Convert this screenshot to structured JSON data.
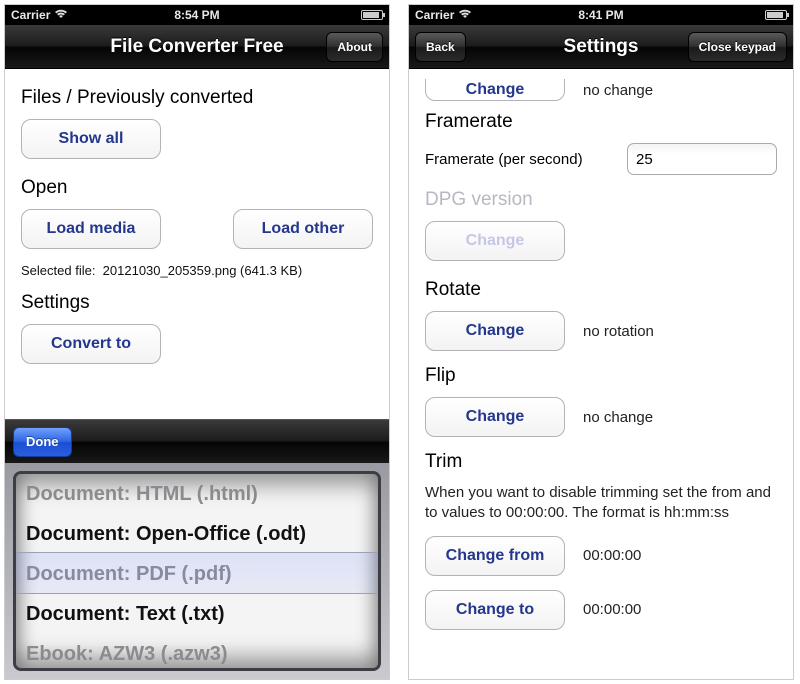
{
  "left": {
    "statusbar": {
      "carrier": "Carrier",
      "time": "8:54 PM"
    },
    "navbar": {
      "title": "File Converter Free",
      "about": "About"
    },
    "files_section": {
      "label": "Files / Previously converted",
      "show_all": "Show all"
    },
    "open_section": {
      "label": "Open",
      "load_media": "Load media",
      "load_other": "Load other",
      "selected_prefix": "Selected file:",
      "selected_file": "20121030_205359.png (641.3 KB)"
    },
    "settings_section": {
      "label": "Settings",
      "convert_to": "Convert to"
    },
    "picker": {
      "done": "Done",
      "items": [
        "Document: HTML (.html)",
        "Document: Open-Office (.odt)",
        "Document: PDF (.pdf)",
        "Document: Text (.txt)",
        "Ebook: AZW3 (.azw3)"
      ],
      "selected_index": 2
    }
  },
  "right": {
    "statusbar": {
      "carrier": "Carrier",
      "time": "8:41 PM"
    },
    "navbar": {
      "back": "Back",
      "title": "Settings",
      "close_keypad": "Close keypad"
    },
    "top_partial": {
      "button": "Change",
      "value": "no change"
    },
    "framerate": {
      "label": "Framerate",
      "field_label": "Framerate (per second)",
      "value": "25"
    },
    "dpg": {
      "label": "DPG version",
      "button": "Change"
    },
    "rotate": {
      "label": "Rotate",
      "button": "Change",
      "value": "no rotation"
    },
    "flip": {
      "label": "Flip",
      "button": "Change",
      "value": "no change"
    },
    "trim": {
      "label": "Trim",
      "hint": "When you want to disable trimming set the from and to values to 00:00:00. The format is hh:mm:ss",
      "change_from": "Change from",
      "from_value": "00:00:00",
      "change_to": "Change to",
      "to_value": "00:00:00"
    }
  }
}
